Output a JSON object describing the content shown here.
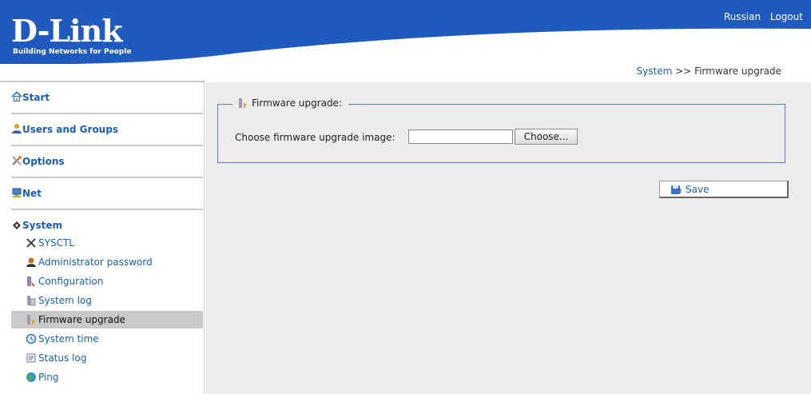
{
  "header": {
    "logo_main": "D-Link",
    "logo_tagline": "Building Networks for People",
    "links": [
      "Russian",
      "Logout"
    ],
    "brand_color": "#1f5bbf"
  },
  "breadcrumb": {
    "parent": "System",
    "separator": ">>",
    "current": "Firmware upgrade"
  },
  "sidebar": {
    "sections": [
      {
        "label": "Start",
        "icon": "home-icon"
      },
      {
        "label": "Users and Groups",
        "icon": "users-icon"
      },
      {
        "label": "Options",
        "icon": "tools-icon"
      },
      {
        "label": "Net",
        "icon": "network-icon"
      },
      {
        "label": "System",
        "icon": "gear-icon"
      }
    ],
    "system_items": [
      {
        "label": "SYSCTL",
        "icon": "wrench-icon"
      },
      {
        "label": "Administrator password",
        "icon": "admin-user-icon"
      },
      {
        "label": "Configuration",
        "icon": "configuration-icon"
      },
      {
        "label": "System log",
        "icon": "log-icon"
      },
      {
        "label": "Firmware upgrade",
        "icon": "firmware-icon",
        "active": true
      },
      {
        "label": "System time",
        "icon": "clock-icon"
      },
      {
        "label": "Status log",
        "icon": "status-log-icon"
      },
      {
        "label": "Ping",
        "icon": "ping-icon"
      }
    ]
  },
  "main": {
    "fieldset_legend": "Firmware upgrade:",
    "choose_label": "Choose firmware upgrade image:",
    "file_value": "",
    "choose_button": "Choose...",
    "save_button": "Save"
  }
}
